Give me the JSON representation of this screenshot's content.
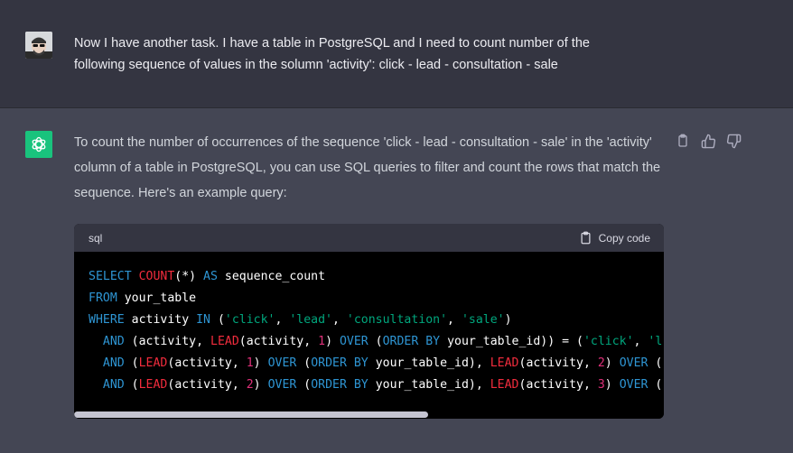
{
  "user_message": {
    "line1": "Now I have another task. I have a table in PostgreSQL and I need to count number of the",
    "line2": "following sequence of values in the solumn 'activity': click - lead - consultation - sale"
  },
  "assistant_message": {
    "text": "To count the number of occurrences of the sequence 'click - lead - consultation - sale' in the 'activity' column of a table in PostgreSQL, you can use SQL queries to filter and count the rows that match the sequence. Here's an example query:"
  },
  "code_block": {
    "language": "sql",
    "copy_label": "Copy code",
    "lines": [
      [
        [
          "kw",
          "SELECT "
        ],
        [
          "fn",
          "COUNT"
        ],
        [
          "plain",
          "(*) "
        ],
        [
          "kw",
          "AS"
        ],
        [
          "plain",
          " sequence_count"
        ]
      ],
      [
        [
          "kw",
          "FROM"
        ],
        [
          "plain",
          " your_table"
        ]
      ],
      [
        [
          "kw",
          "WHERE"
        ],
        [
          "plain",
          " activity "
        ],
        [
          "kw",
          "IN"
        ],
        [
          "plain",
          " ("
        ],
        [
          "str",
          "'click'"
        ],
        [
          "plain",
          ", "
        ],
        [
          "str",
          "'lead'"
        ],
        [
          "plain",
          ", "
        ],
        [
          "str",
          "'consultation'"
        ],
        [
          "plain",
          ", "
        ],
        [
          "str",
          "'sale'"
        ],
        [
          "plain",
          ")"
        ]
      ],
      [
        [
          "plain",
          "  "
        ],
        [
          "kw",
          "AND"
        ],
        [
          "plain",
          " (activity, "
        ],
        [
          "fn",
          "LEAD"
        ],
        [
          "plain",
          "(activity, "
        ],
        [
          "num",
          "1"
        ],
        [
          "plain",
          ") "
        ],
        [
          "kw",
          "OVER"
        ],
        [
          "plain",
          " ("
        ],
        [
          "kw",
          "ORDER BY"
        ],
        [
          "plain",
          " your_table_id)) = ("
        ],
        [
          "str",
          "'click'"
        ],
        [
          "plain",
          ", "
        ],
        [
          "str",
          "'l"
        ]
      ],
      [
        [
          "plain",
          "  "
        ],
        [
          "kw",
          "AND"
        ],
        [
          "plain",
          " ("
        ],
        [
          "fn",
          "LEAD"
        ],
        [
          "plain",
          "(activity, "
        ],
        [
          "num",
          "1"
        ],
        [
          "plain",
          ") "
        ],
        [
          "kw",
          "OVER"
        ],
        [
          "plain",
          " ("
        ],
        [
          "kw",
          "ORDER BY"
        ],
        [
          "plain",
          " your_table_id), "
        ],
        [
          "fn",
          "LEAD"
        ],
        [
          "plain",
          "(activity, "
        ],
        [
          "num",
          "2"
        ],
        [
          "plain",
          ") "
        ],
        [
          "kw",
          "OVER"
        ],
        [
          "plain",
          " ("
        ]
      ],
      [
        [
          "plain",
          "  "
        ],
        [
          "kw",
          "AND"
        ],
        [
          "plain",
          " ("
        ],
        [
          "fn",
          "LEAD"
        ],
        [
          "plain",
          "(activity, "
        ],
        [
          "num",
          "2"
        ],
        [
          "plain",
          ") "
        ],
        [
          "kw",
          "OVER"
        ],
        [
          "plain",
          " ("
        ],
        [
          "kw",
          "ORDER BY"
        ],
        [
          "plain",
          " your_table_id), "
        ],
        [
          "fn",
          "LEAD"
        ],
        [
          "plain",
          "(activity, "
        ],
        [
          "num",
          "3"
        ],
        [
          "plain",
          ") "
        ],
        [
          "kw",
          "OVER"
        ],
        [
          "plain",
          " ("
        ]
      ]
    ],
    "scroll_fraction": 0.6
  },
  "icons": [
    "user-avatar-icon",
    "chatgpt-logo-icon",
    "clipboard-icon",
    "thumbs-up-icon",
    "thumbs-down-icon"
  ],
  "colors": {
    "bg_user": "#343541",
    "bg_assistant": "#444654",
    "logo_green": "#19c37d",
    "code_keyword": "#2e95d3",
    "code_function": "#f22c3d",
    "code_string": "#00a67d",
    "code_number": "#df3079"
  }
}
